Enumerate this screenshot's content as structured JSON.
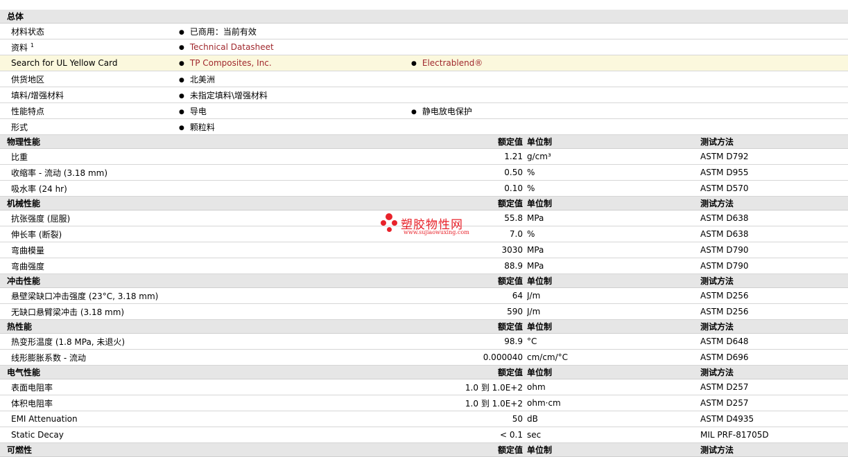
{
  "sections": {
    "general": "总体",
    "physical": "物理性能",
    "mechanical": "机械性能",
    "impact": "冲击性能",
    "thermal": "热性能",
    "electrical": "电气性能",
    "next_partial": "可燃性"
  },
  "headers": {
    "nominal": "额定值",
    "unit": "单位制",
    "method": "测试方法"
  },
  "general": {
    "status_label": "材料状态",
    "status_value": "已商用：当前有效",
    "docs_label": "资料",
    "docs_sup": "1",
    "docs_link": "Technical Datasheet",
    "ul_label": "Search for UL Yellow Card",
    "ul_link1": "TP Composites, Inc.",
    "ul_link2": "Electrablend®",
    "region_label": "供货地区",
    "region_value": "北美洲",
    "filler_label": "填料/增强材料",
    "filler_value": "未指定填料\\增强材料",
    "features_label": "性能特点",
    "feature1": "导电",
    "feature2": "静电放电保护",
    "form_label": "形式",
    "form_value": "颗粒料"
  },
  "physical": [
    {
      "name": "比重",
      "value": "1.21",
      "unit": "g/cm³",
      "method": "ASTM D792"
    },
    {
      "name": "收缩率  - 流动  (3.18 mm)",
      "value": "0.50",
      "unit": "%",
      "method": "ASTM D955"
    },
    {
      "name": "吸水率  (24 hr)",
      "value": "0.10",
      "unit": "%",
      "method": "ASTM D570"
    }
  ],
  "mechanical": [
    {
      "name": "抗张强度  (屈服)",
      "value": "55.8",
      "unit": "MPa",
      "method": "ASTM D638"
    },
    {
      "name": "伸长率  (断裂)",
      "value": "7.0",
      "unit": "%",
      "method": "ASTM D638"
    },
    {
      "name": "弯曲模量",
      "value": "3030",
      "unit": "MPa",
      "method": "ASTM D790"
    },
    {
      "name": "弯曲强度",
      "value": "88.9",
      "unit": "MPa",
      "method": "ASTM D790"
    }
  ],
  "impact": [
    {
      "name": "悬壁梁缺口冲击强度  (23°C, 3.18 mm)",
      "value": "64",
      "unit": "J/m",
      "method": "ASTM D256"
    },
    {
      "name": "无缺口悬臂梁冲击  (3.18 mm)",
      "value": "590",
      "unit": "J/m",
      "method": "ASTM D256"
    }
  ],
  "thermal": [
    {
      "name": "热变形温度  (1.8 MPa, 未退火)",
      "value": "98.9",
      "unit": "°C",
      "method": "ASTM D648"
    },
    {
      "name": "线形膨胀系数  - 流动",
      "value": "0.000040",
      "unit": "cm/cm/°C",
      "method": "ASTM D696"
    }
  ],
  "electrical": [
    {
      "name": "表面电阻率",
      "value": "1.0 到  1.0E+2",
      "unit": "ohm",
      "method": "ASTM D257"
    },
    {
      "name": "体积电阻率",
      "value": "1.0 到  1.0E+2",
      "unit": "ohm·cm",
      "method": "ASTM D257"
    },
    {
      "name": "EMI Attenuation",
      "value": "50",
      "unit": "dB",
      "method": "ASTM D4935"
    },
    {
      "name": "Static Decay",
      "value": "< 0.1",
      "unit": "sec",
      "method": "MIL PRF-81705D"
    }
  ],
  "watermark": {
    "title": "塑胶物性网",
    "url": "www.sujiaowuxing.com"
  },
  "colors": {
    "link": "#a0282d",
    "section_bg": "#e6e6e6",
    "highlight": "#fbf8dd",
    "watermark": "#e8222a"
  }
}
